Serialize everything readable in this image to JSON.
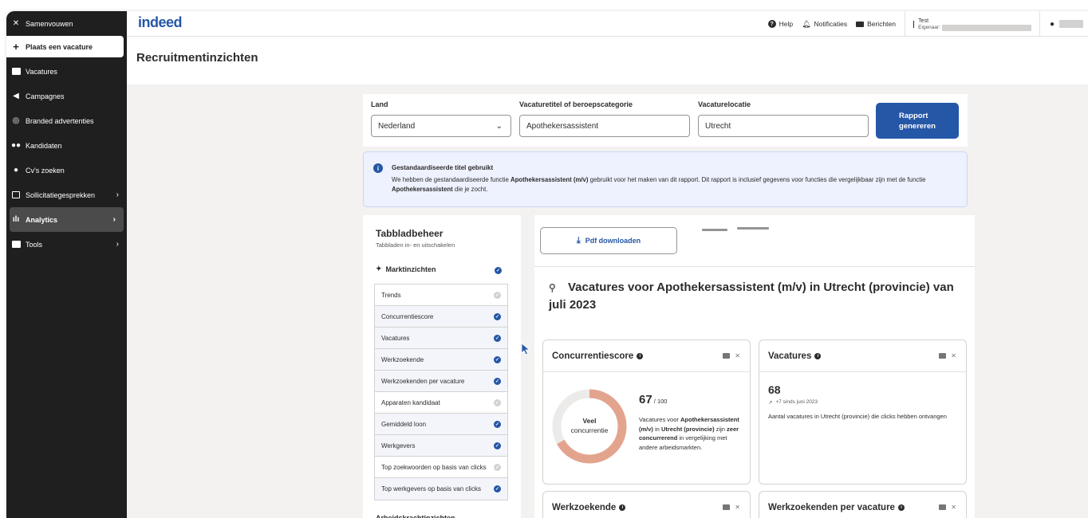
{
  "sidebar": {
    "collapse": "Samenvouwen",
    "post_job": "Plaats een vacature",
    "items": [
      {
        "label": "Vacatures"
      },
      {
        "label": "Campagnes"
      },
      {
        "label": "Branded advertenties"
      },
      {
        "label": "Kandidaten"
      },
      {
        "label": "Cv's zoeken"
      },
      {
        "label": "Sollicitatiegesprekken"
      },
      {
        "label": "Analytics"
      },
      {
        "label": "Tools"
      }
    ]
  },
  "header": {
    "logo": "indeed",
    "help": "Help",
    "notifications": "Notificaties",
    "messages": "Berichten",
    "account_name": "Test",
    "owner_label": "Eigenaar:"
  },
  "page": {
    "title": "Recruitmentinzichten"
  },
  "filters": {
    "country_label": "Land",
    "country_value": "Nederland",
    "title_label": "Vacaturetitel of beroepscategorie",
    "title_value": "Apothekersassistent",
    "location_label": "Vacaturelocatie",
    "location_value": "Utrecht",
    "generate_line1": "Rapport",
    "generate_line2": "genereren"
  },
  "notice": {
    "title": "Gestandaardiseerde titel gebruikt",
    "body_1": "We hebben de gestandaardiseerde functie ",
    "body_bold_1": "Apothekersassistent (m/v)",
    "body_2": " gebruikt voor het maken van dit rapport. Dit rapport is inclusief gegevens voor functies die vergelijkbaar zijn met de functie ",
    "body_bold_2": "Apothekersassistent",
    "body_3": " die je zocht."
  },
  "tabs": {
    "title": "Tabbladbeheer",
    "subtitle": "Tabbladen in- en uitschakelen",
    "section": "Marktinzichten",
    "next_section": "Arbeidskrachtinzichten",
    "items": [
      {
        "label": "Trends",
        "on": false
      },
      {
        "label": "Concurrentiescore",
        "on": true
      },
      {
        "label": "Vacatures",
        "on": true
      },
      {
        "label": "Werkzoekende",
        "on": true
      },
      {
        "label": "Werkzoekenden per vacature",
        "on": true
      },
      {
        "label": "Apparaten kandidaat",
        "on": false
      },
      {
        "label": "Gemiddeld loon",
        "on": true
      },
      {
        "label": "Werkgevers",
        "on": true
      },
      {
        "label": "Top zoekwoorden op basis van clicks",
        "on": false
      },
      {
        "label": "Top werkgevers op basis van clicks",
        "on": true
      }
    ]
  },
  "report": {
    "pdf_button": "Pdf downloaden",
    "headline_1": "Vacatures voor ",
    "headline_bold_1": "Apothekersassistent (m/v)",
    "headline_2": " in ",
    "headline_bold_2": "Utrecht (provincie)",
    "headline_3": " van ",
    "headline_bold_3": "juli 2023"
  },
  "cards": {
    "competition": {
      "title": "Concurrentiescore",
      "score": "67",
      "score_max": " / 100",
      "score_fraction": 0.67,
      "donut_line1": "Veel",
      "donut_line2": "concurrentie",
      "desc_1": "Vacatures voor ",
      "desc_bold_1": "Apothekersassistent (m/v)",
      "desc_2": " in ",
      "desc_bold_2": "Utrecht (provincie)",
      "desc_3": " zijn ",
      "desc_bold_3": "zeer concurrerend",
      "desc_4": " in vergelijking met andere arbeidsmarkten."
    },
    "vacancies": {
      "title": "Vacatures",
      "count": "68",
      "trend": "+7 sinds juni 2023",
      "desc": "Aantal vacatures in Utrecht (provincie) die clicks hebben ontvangen"
    },
    "jobseekers": {
      "title": "Werkzoekende"
    },
    "per_vacancy": {
      "title": "Werkzoekenden per vacature"
    }
  },
  "colors": {
    "brand_blue": "#2557a7",
    "donut_fill": "#e3a48e",
    "donut_track": "#ecebea"
  }
}
